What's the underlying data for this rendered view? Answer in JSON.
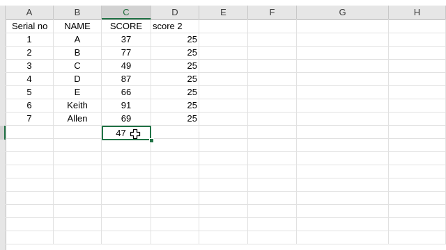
{
  "columns": [
    "A",
    "B",
    "C",
    "D",
    "E",
    "F",
    "G",
    "H"
  ],
  "selected_column": "C",
  "headers": {
    "a": "Serial no",
    "b": "NAME",
    "c": "SCORE",
    "d": "score 2"
  },
  "rows": [
    {
      "serial": "1",
      "name": "A",
      "score": "37",
      "score2": "25"
    },
    {
      "serial": "2",
      "name": "B",
      "score": "77",
      "score2": "25"
    },
    {
      "serial": "3",
      "name": "C",
      "score": "49",
      "score2": "25"
    },
    {
      "serial": "4",
      "name": "D",
      "score": "87",
      "score2": "25"
    },
    {
      "serial": "5",
      "name": "E",
      "score": "66",
      "score2": "25"
    },
    {
      "serial": "6",
      "name": "Keith",
      "score": "91",
      "score2": "25"
    },
    {
      "serial": "7",
      "name": "Allen",
      "score": "69",
      "score2": "25"
    }
  ],
  "active_cell": {
    "value": "47"
  },
  "colors": {
    "selection": "#217346",
    "header_bg": "#e6e6e6",
    "gridline": "#e1e1e1"
  },
  "icons": {
    "cursor": "excel-cross-cursor-icon"
  }
}
